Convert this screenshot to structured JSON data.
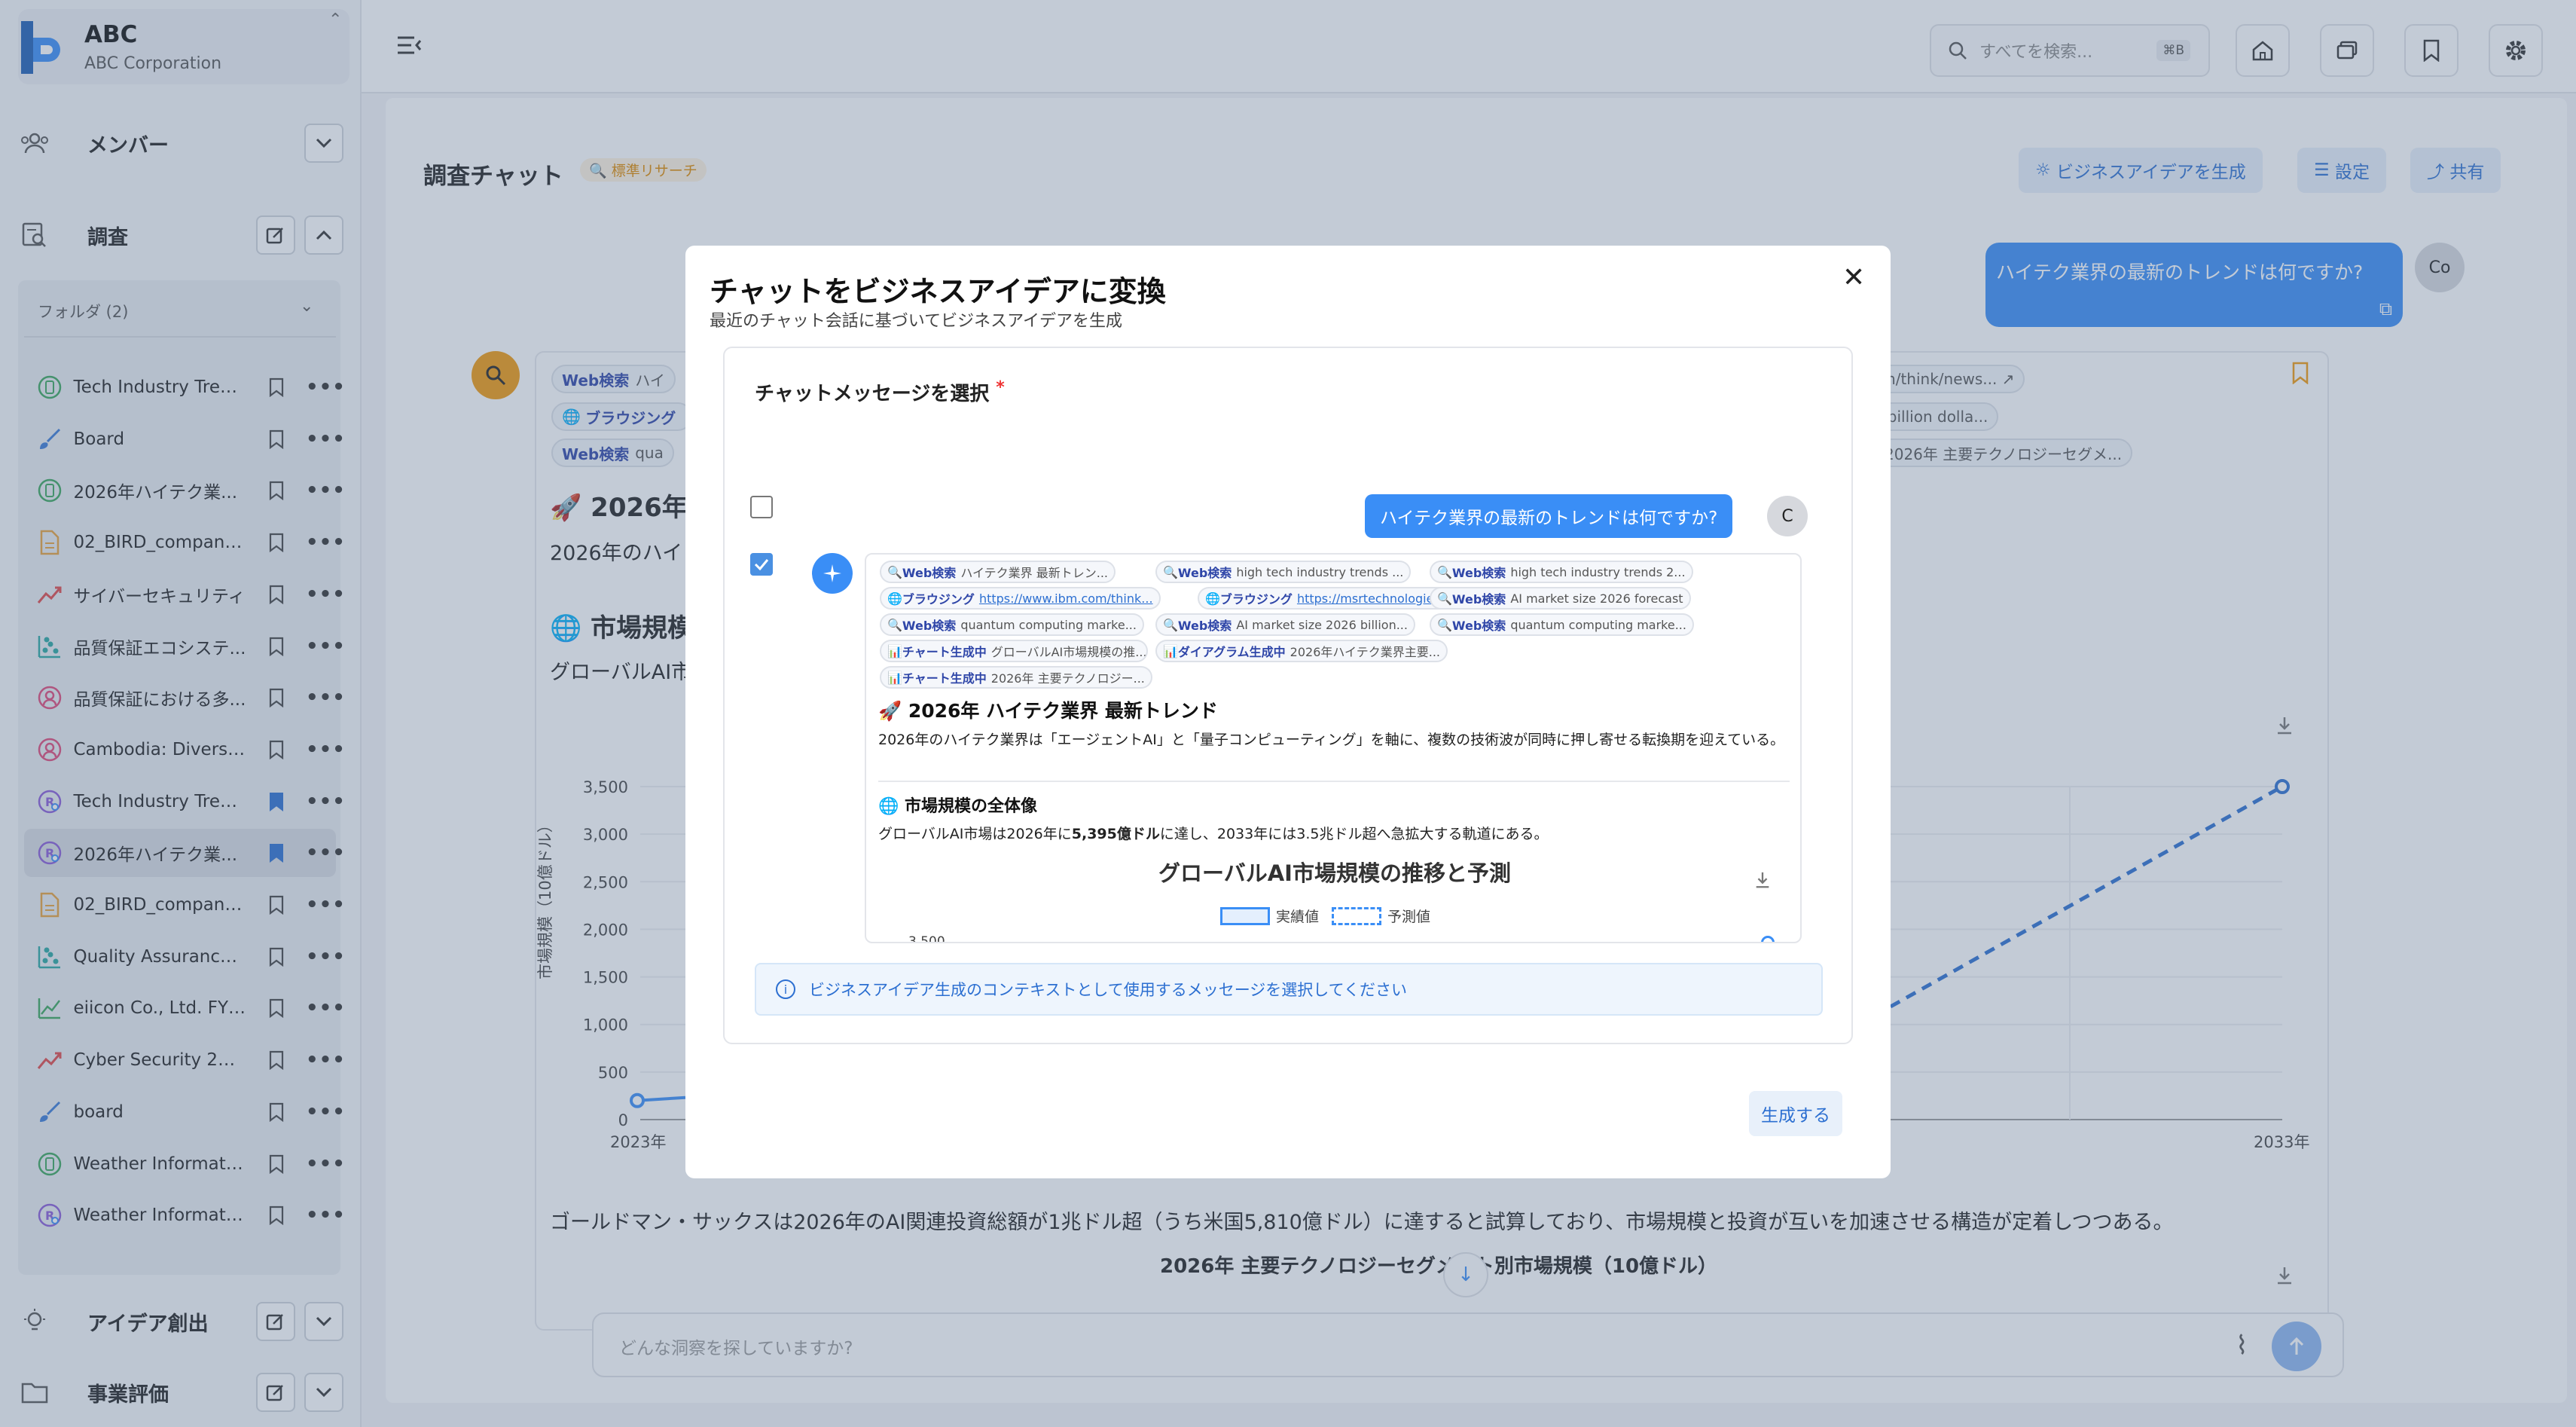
{
  "org": {
    "name": "ABC",
    "subtitle": "ABC Corporation",
    "collapse_icon": "chevron-up-down-icon"
  },
  "sidebar": {
    "sections": {
      "members": "メンバー",
      "research": "調査",
      "idea": "アイデア創出",
      "evaluation": "事業評価"
    },
    "folder_header": "フォルダ (2)",
    "items": [
      {
        "label": "Tech Industry Trend...",
        "icon": "doc-circle-icon",
        "bookmarked": false
      },
      {
        "label": "Board",
        "icon": "brush-icon",
        "bookmarked": false
      },
      {
        "label": "2026年ハイテク業...",
        "icon": "doc-circle-icon",
        "bookmarked": false
      },
      {
        "label": "02_BIRD_company_...",
        "icon": "file-icon",
        "bookmarked": false
      },
      {
        "label": "サイバーセキュリティ",
        "icon": "trend-icon",
        "bookmarked": false
      },
      {
        "label": "品質保証エコシステ...",
        "icon": "scatter-icon",
        "bookmarked": false
      },
      {
        "label": "品質保証における多...",
        "icon": "person-circle-icon",
        "bookmarked": false
      },
      {
        "label": "Cambodia: Diverse ...",
        "icon": "person-circle-icon",
        "bookmarked": false
      },
      {
        "label": "Tech Industry Trend...",
        "icon": "research-circle-icon",
        "bookmarked": true
      },
      {
        "label": "2026年ハイテク業...",
        "icon": "research-circle-icon",
        "bookmarked": true,
        "active": true
      },
      {
        "label": "02_BIRD_company_...",
        "icon": "file-icon",
        "bookmarked": false
      },
      {
        "label": "Quality Assurance ...",
        "icon": "scatter-icon",
        "bookmarked": false
      },
      {
        "label": "eiicon Co., Ltd. FY2...",
        "icon": "line-chart-icon",
        "bookmarked": false
      },
      {
        "label": "Cyber Security 2026",
        "icon": "trend-icon",
        "bookmarked": false
      },
      {
        "label": "board",
        "icon": "brush-icon",
        "bookmarked": false
      },
      {
        "label": "Weather Informatio...",
        "icon": "doc-circle-icon",
        "bookmarked": false
      },
      {
        "label": "Weather Informatio...",
        "icon": "research-circle-icon",
        "bookmarked": false
      }
    ],
    "more_label": "•••"
  },
  "header": {
    "search_placeholder": "すべてを検索...",
    "shortcut": "⌘B"
  },
  "main": {
    "title": "調査チャット",
    "badge": "標準リサーチ",
    "buttons": {
      "idea": "ビジネスアイデアを生成",
      "settings": "設定",
      "share": "共有"
    },
    "user_message": "ハイテク業界の最新のトレンドは何ですか?",
    "user_avatar": "Co",
    "bg_chips": [
      {
        "kind": "Web検索",
        "text": "ハイ"
      },
      {
        "kind": "",
        "text": "com/think/news..."
      },
      {
        "kind": "ブラウジング",
        "text": ""
      },
      {
        "kind": "",
        "text": "26 billion dolla..."
      },
      {
        "kind": "Web検索",
        "text": "qua"
      },
      {
        "kind": "中",
        "text": "2026年 主要テクノロジーセグメ..."
      }
    ],
    "bg_heading1": "🚀 2026年",
    "bg_text1": "2026年のハイ",
    "bg_heading2": "🌐 市場規模の",
    "bg_text2": "グローバルAI市",
    "chart_bg": {
      "y_ticks": [
        "3,500",
        "3,000",
        "2,500",
        "2,000",
        "1,500",
        "1,000",
        "500",
        "0"
      ],
      "ylabel": "市場規模（10億ドル）",
      "x_start": "2023年",
      "x_end": "2033年"
    },
    "bg_paragraph": "ゴールドマン・サックスは2026年のAI関連投資総額が1兆ドル超（うち米国5,810億ドル）に達すると試算しており、市場規模と投資が互いを加速させる構造が定着しつつある。",
    "bg_caption": "2026年 主要テクノロジーセグメント別市場規模（10億ドル）",
    "input_placeholder": "どんな洞察を探していますか?"
  },
  "modal": {
    "title": "チャットをビジネスアイデアに変換",
    "subtitle": "最近のチャット会話に基づいてビジネスアイデアを生成",
    "select_label": "チャットメッセージを選択",
    "required_mark": "*",
    "user_message": "ハイテク業界の最新のトレンドは何ですか?",
    "user_avatar": "C",
    "user_checked": false,
    "bot_checked": true,
    "chips": [
      {
        "kind": "Web検索",
        "text": "ハイテク業界 最新トレン..."
      },
      {
        "kind": "Web検索",
        "text": "high tech industry trends ..."
      },
      {
        "kind": "Web検索",
        "text": "high tech industry trends 2..."
      },
      {
        "kind": "ブラウジング",
        "text": "https://www.ibm.com/think..."
      },
      {
        "kind": "ブラウジング",
        "text": "https://msrtechnologies.co..."
      },
      {
        "kind": "Web検索",
        "text": "AI market size 2026 forecast"
      },
      {
        "kind": "Web検索",
        "text": "quantum computing marke..."
      },
      {
        "kind": "Web検索",
        "text": "AI market size 2026 billion..."
      },
      {
        "kind": "Web検索",
        "text": "quantum computing marke..."
      },
      {
        "kind": "チャート生成中",
        "text": "グローバルAI市場規模の推..."
      },
      {
        "kind": "ダイアグラム生成中",
        "text": "2026年ハイテク業界主要..."
      },
      {
        "kind": "チャート生成中",
        "text": "2026年 主要テクノロジー..."
      }
    ],
    "preview_heading": "🚀 2026年 ハイテク業界 最新トレンド",
    "preview_text": "2026年のハイテク業界は「エージェントAI」と「量子コンピューティング」を軸に、複数の技術波が同時に押し寄せる転換期を迎えている。",
    "preview_heading2": "🌐 市場規模の全体像",
    "preview_text2_a": "グローバルAI市場は2026年に",
    "preview_text2_b": "5,395億ドル",
    "preview_text2_c": "に達し、2033年には3.5兆ドル超へ急拡大する軌道にある。",
    "preview_chart_title": "グローバルAI市場規模の推移と予測",
    "legend_actual": "実績値",
    "legend_forecast": "予測値",
    "preview_tick": "3,500",
    "info": "ビジネスアイデア生成のコンテキストとして使用するメッセージを選択してください",
    "generate": "生成する"
  },
  "colors": {
    "accent": "#3a8ef6",
    "orange": "#f19a0e",
    "link": "#2c6fd1"
  }
}
